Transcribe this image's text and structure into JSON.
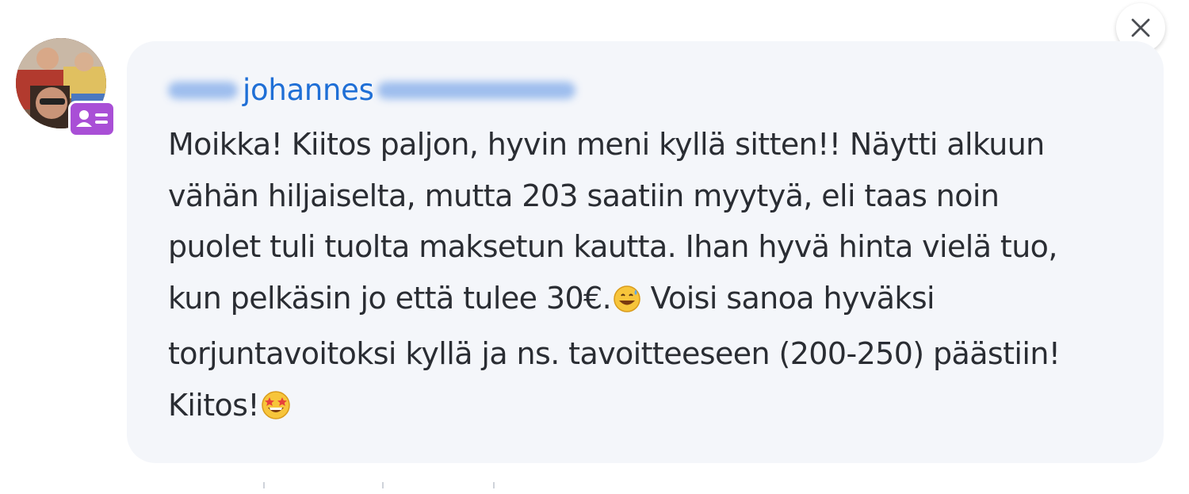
{
  "sender": {
    "name": "johannes"
  },
  "message": {
    "lines": [
      "Moikka! Kiitos paljon, hyvin meni kyllä sitten!! Näytti alkuun",
      "vähän hiljaiselta, mutta 203 saatiin myytyä, eli taas noin",
      "puolet tuli tuolta maksetun kautta. Ihan hyvä hinta vielä tuo,",
      "kun pelkäsin jo että tulee 30€.",
      "Voisi sanoa hyväksi",
      "torjuntavoitoksi kyllä ja ns. tavoitteeseen (200-250) päästiin!",
      "Kiitos!"
    ]
  },
  "icons": {
    "close": "close-icon",
    "badge": "id-card-icon",
    "emoji_1": "grinning-sweat-emoji",
    "emoji_2": "star-struck-emoji"
  },
  "colors": {
    "bubble": "#f4f6fa",
    "sender_link": "#1f6fd6",
    "badge": "#a94fd6",
    "text": "#2a2d33"
  }
}
